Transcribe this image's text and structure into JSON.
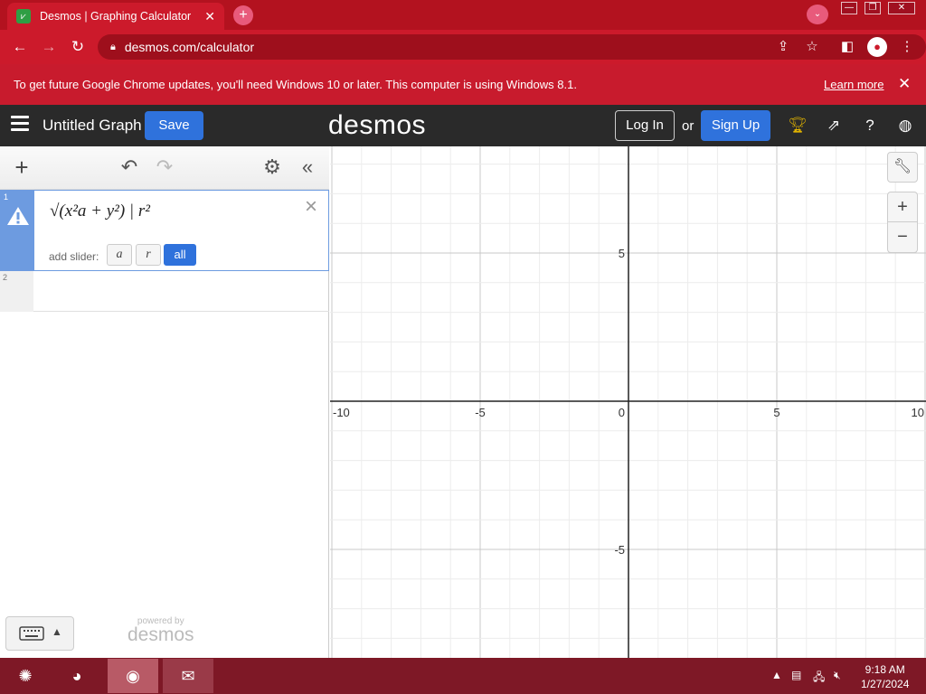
{
  "browser": {
    "tab_title": "Desmos | Graphing Calculator",
    "url": "desmos.com/calculator",
    "new_tab": "+",
    "tab_close": "✕"
  },
  "infobar": {
    "message": "To get future Google Chrome updates, you'll need Windows 10 or later. This computer is using Windows 8.1.",
    "learn_more": "Learn more",
    "close": "✕"
  },
  "header": {
    "title": "Untitled Graph",
    "save": "Save",
    "logo": "desmos",
    "login": "Log In",
    "or": "or",
    "signup": "Sign Up"
  },
  "expressions": [
    {
      "index": "1",
      "latex_display": "√(x²a + y²) | r²",
      "has_warning": true,
      "add_slider_label": "add slider:",
      "sliders": [
        "a",
        "r",
        "all"
      ]
    },
    {
      "index": "2"
    }
  ],
  "powered_by": {
    "line1": "powered by",
    "line2": "desmos"
  },
  "graph": {
    "x_labels": [
      "-10",
      "-5",
      "0",
      "5",
      "10"
    ],
    "y_labels": [
      "5",
      "-5"
    ]
  },
  "taskbar": {
    "time": "9:18 AM",
    "date": "1/27/2024"
  },
  "colors": {
    "browser_red": "#cc1a2b",
    "desmos_header": "#2a2a2a",
    "desmos_blue": "#2f72dc",
    "expression_highlight": "#6d9be0",
    "taskbar": "#7e1826"
  }
}
